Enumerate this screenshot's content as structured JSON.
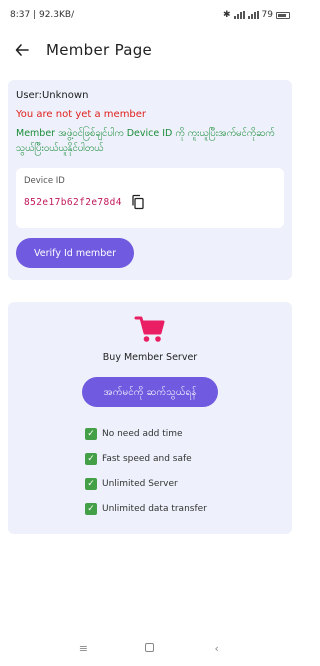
{
  "status_bar": {
    "time_info": "8:37 | 92.3KB/",
    "battery_label": "79"
  },
  "app_bar": {
    "title": "Member Page"
  },
  "user_card": {
    "user_line": "User:Unknown",
    "not_member": "You are not yet a member",
    "info_message": "Member အဖွဲ့ဝင်ဖြစ်ချင်ပါက Device ID ကို ကူးယူပြီးအက်မင်ကိုဆက်သွယ်ပြီးဝယ်ယူနိုင်ပါတယ်",
    "device_label": "Device ID",
    "device_id": "852e17b62f2e78d4",
    "verify_button": "Verify Id member"
  },
  "buy_card": {
    "title": "Buy Member Server",
    "connect_button": "အက်မင်ကို ဆက်သွယ်ရန်",
    "features": [
      "No need add time",
      "Fast speed and safe",
      "Unlimited Server",
      "Unlimited data transfer"
    ]
  },
  "colors": {
    "accent": "#6f5ae0",
    "error": "#e0201c",
    "success": "#1a8c3a",
    "device_id": "#c2185b",
    "card_bg": "#eef1fb"
  }
}
